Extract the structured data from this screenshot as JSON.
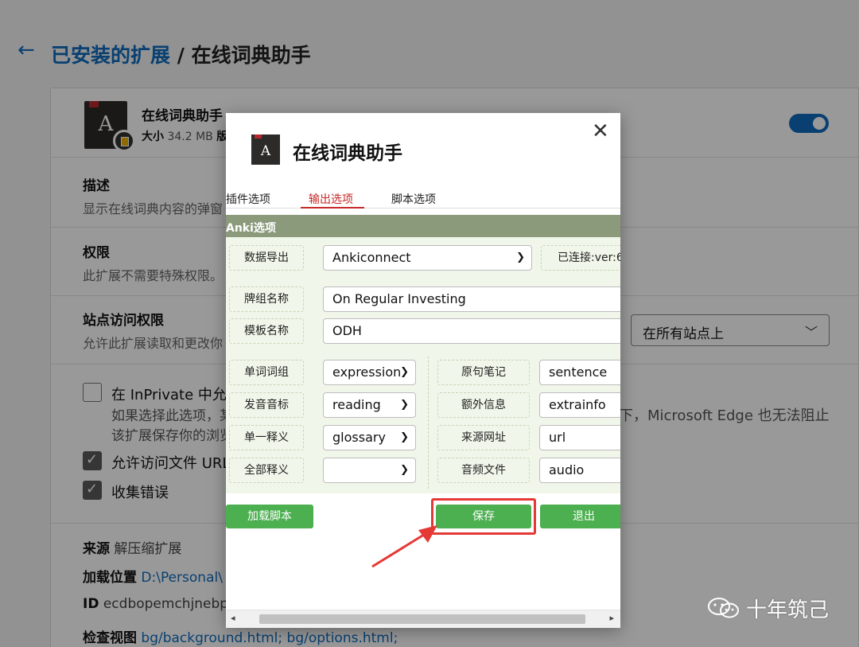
{
  "header": {
    "back_icon": "←",
    "breadcrumb_link": "已安装的扩展",
    "separator": "/",
    "current": "在线词典助手"
  },
  "extension": {
    "name": "在线词典助手",
    "size_label": "大小",
    "size_value": "34.2 MB",
    "size_trunc": "版",
    "icon_letter": "A",
    "enabled": true
  },
  "sections": {
    "description": {
      "title": "描述",
      "text": "显示在线词典内容的弹窗"
    },
    "permissions": {
      "title": "权限",
      "text": "此扩展不需要特殊权限。"
    },
    "site_access": {
      "title": "站点访问权限",
      "text": "允许此扩展读取和更改你",
      "select_value": "在所有站点上"
    }
  },
  "options": {
    "inprivate": {
      "label": "在 InPrivate 中允许",
      "checked": false,
      "sub1": "如果选择此选项，某",
      "sub2": "该扩展保存你的浏览",
      "tail": "下，Microsoft Edge 也无法阻止"
    },
    "file_urls": {
      "label": "允许访问文件 URL",
      "checked": true
    },
    "collect_errors": {
      "label": "收集错误",
      "checked": true
    }
  },
  "meta": {
    "source_label": "来源",
    "source_value": "解压缩扩展",
    "location_label": "加载位置",
    "location_value": "D:\\Personal\\",
    "id_label": "ID",
    "id_value": "ecdbopemchjnebp",
    "inspect_label": "检查视图",
    "inspect_value": "bg/background.html;  bg/options.html;"
  },
  "watermark": {
    "text": "十年筑己",
    "icon": "wechat-icon"
  },
  "dialog": {
    "title": "在线词典助手",
    "icon_letter": "A",
    "close": "✕",
    "tabs": [
      {
        "label": "插件选项",
        "active": false
      },
      {
        "label": "输出选项",
        "active": true
      },
      {
        "label": "脚本选项",
        "active": false
      }
    ],
    "section_header": "Anki选项",
    "export": {
      "label": "数据导出",
      "value": "Ankiconnect",
      "status": "已连接:ver:6"
    },
    "deck": {
      "label": "牌组名称",
      "value": "On Regular Investing"
    },
    "model": {
      "label": "模板名称",
      "value": "ODH"
    },
    "fields_left": [
      {
        "label": "单词词组",
        "value": "expression"
      },
      {
        "label": "发音音标",
        "value": "reading"
      },
      {
        "label": "单一释义",
        "value": "glossary"
      },
      {
        "label": "全部释义",
        "value": ""
      }
    ],
    "fields_right": [
      {
        "label": "原句笔记",
        "value": "sentence"
      },
      {
        "label": "额外信息",
        "value": "extrainfo"
      },
      {
        "label": "来源网址",
        "value": "url"
      },
      {
        "label": "音频文件",
        "value": "audio"
      }
    ],
    "buttons": {
      "load_script": "加载脚本",
      "save": "保存",
      "exit": "退出"
    },
    "scroll": {
      "left": "◂",
      "right": "▸"
    },
    "accent": "#4caf50",
    "highlight_color": "#e53935"
  }
}
